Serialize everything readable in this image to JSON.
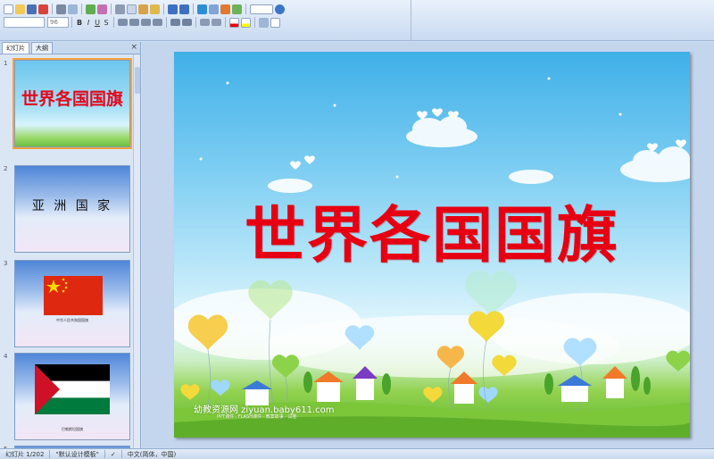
{
  "toolbar": {
    "font_name": "",
    "font_size": "96"
  },
  "panel": {
    "tabs": [
      "幻灯片",
      "大纲"
    ],
    "close_glyph": "×"
  },
  "thumbnails": [
    {
      "number": "1",
      "title": "世界各国国旗"
    },
    {
      "number": "2",
      "text": "亚 洲 国 家"
    },
    {
      "number": "3",
      "caption": "中华人民共和国国旗"
    },
    {
      "number": "4",
      "caption": "巴勒斯坦国旗"
    },
    {
      "number": "5"
    }
  ],
  "slide": {
    "title": "世界各国国旗",
    "watermark_main": "幼教资源网 ziyuan.baby611.com",
    "watermark_sub": "PPT课件 · FLASH课件 · 教案故事 · 试卷"
  },
  "status": {
    "slide_counter": "幻灯片 1/202",
    "template": "\"默认设计模板\"",
    "language": "中文(简体，中国)"
  },
  "colors": {
    "title_red": "#e60012",
    "selection_orange": "#f6a23c",
    "china_red": "#de2910",
    "china_yellow": "#ffde00",
    "palestine_green": "#007a3d",
    "palestine_red": "#ce1126"
  }
}
